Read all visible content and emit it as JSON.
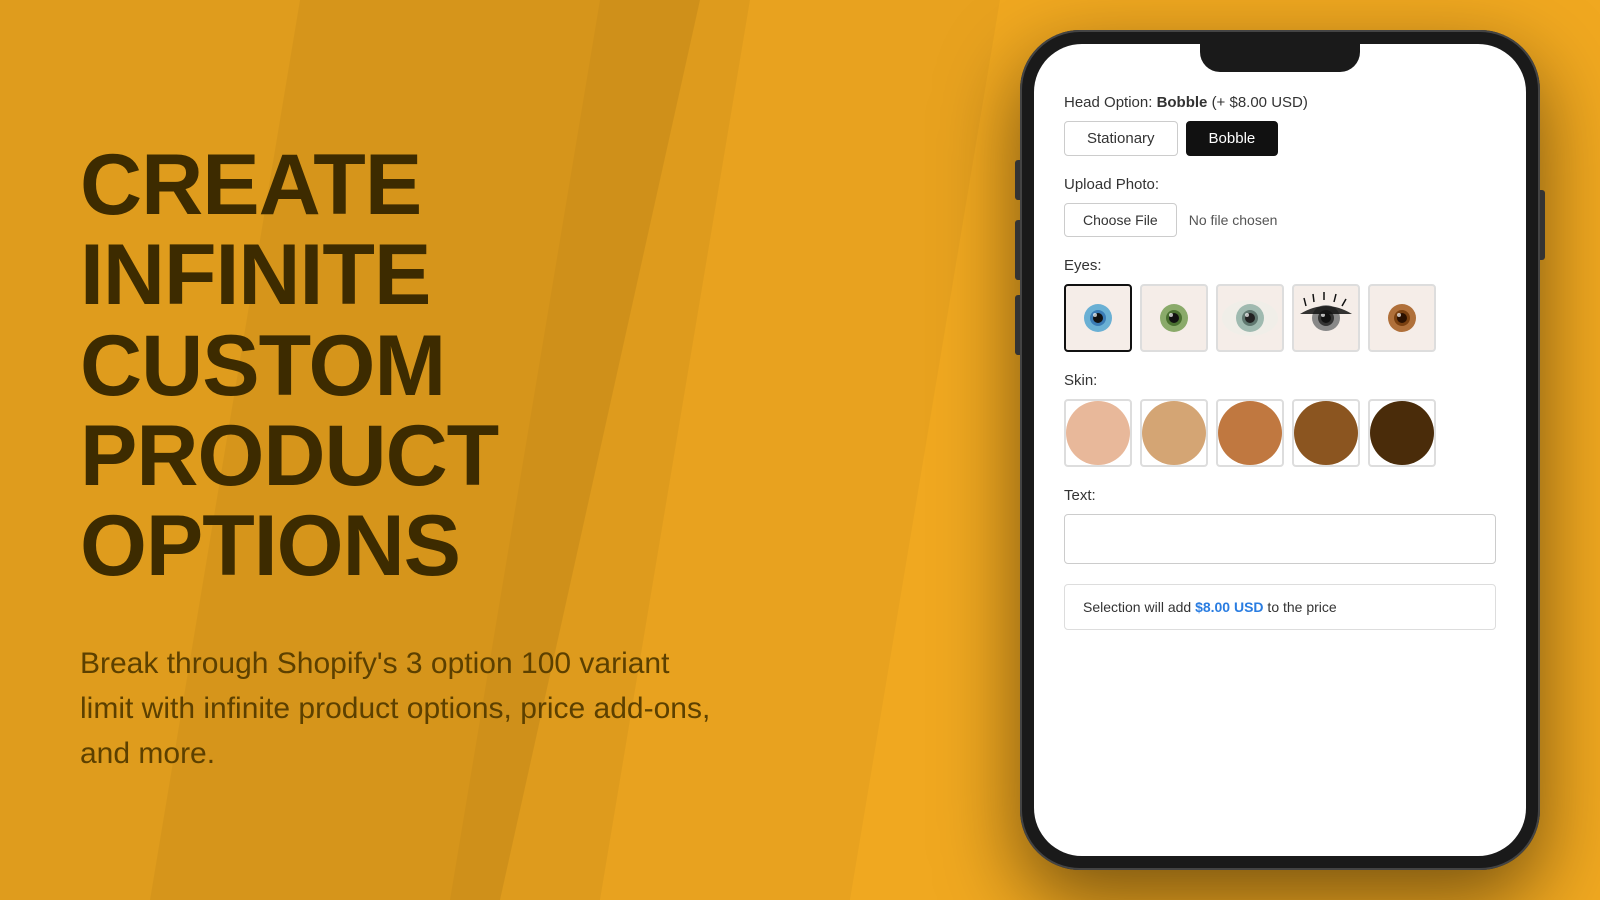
{
  "background": {
    "color": "#F0A820"
  },
  "left": {
    "title_line1": "CREATE",
    "title_line2": "INFINITE CUSTOM",
    "title_line3": "PRODUCT OPTIONS",
    "subtitle": "Break through Shopify's 3 option 100 variant limit with infinite product options, price add-ons, and more."
  },
  "phone": {
    "head_option": {
      "label": "Head Option:",
      "value": "Bobble",
      "price_addon": "(+ $8.00 USD)",
      "buttons": [
        {
          "id": "stationary",
          "label": "Stationary",
          "active": false
        },
        {
          "id": "bobble",
          "label": "Bobble",
          "active": true
        }
      ]
    },
    "upload_photo": {
      "label": "Upload Photo:",
      "button_label": "Choose File",
      "no_file_text": "No file chosen"
    },
    "eyes": {
      "label": "Eyes:",
      "options": [
        {
          "id": "eye1",
          "selected": true,
          "color1": "#6ab0d4",
          "color2": "#3a7bb5",
          "desc": "blue eye"
        },
        {
          "id": "eye2",
          "selected": false,
          "color1": "#7a9e5e",
          "color2": "#4a7030",
          "desc": "green eye"
        },
        {
          "id": "eye3",
          "selected": false,
          "color1": "#8fa8a0",
          "color2": "#5a7570",
          "desc": "grey eye"
        },
        {
          "id": "eye4",
          "selected": false,
          "color1": "#222",
          "color2": "#111",
          "desc": "dark eye with lashes"
        },
        {
          "id": "eye5",
          "selected": false,
          "color1": "#8b5a2b",
          "color2": "#6b3a0b",
          "desc": "brown eye"
        }
      ]
    },
    "skin": {
      "label": "Skin:",
      "options": [
        {
          "id": "skin1",
          "selected": false,
          "color": "#E8B89A",
          "desc": "light skin"
        },
        {
          "id": "skin2",
          "selected": false,
          "color": "#D4A574",
          "desc": "medium light skin"
        },
        {
          "id": "skin3",
          "selected": false,
          "color": "#C07840",
          "desc": "medium skin"
        },
        {
          "id": "skin4",
          "selected": false,
          "color": "#8B5520",
          "desc": "medium dark skin"
        },
        {
          "id": "skin5",
          "selected": false,
          "color": "#4A2C0A",
          "desc": "dark skin"
        }
      ]
    },
    "text": {
      "label": "Text:",
      "placeholder": ""
    },
    "price_notice": {
      "prefix": "Selection will add ",
      "price": "$8.00 USD",
      "suffix": " to the price"
    }
  }
}
